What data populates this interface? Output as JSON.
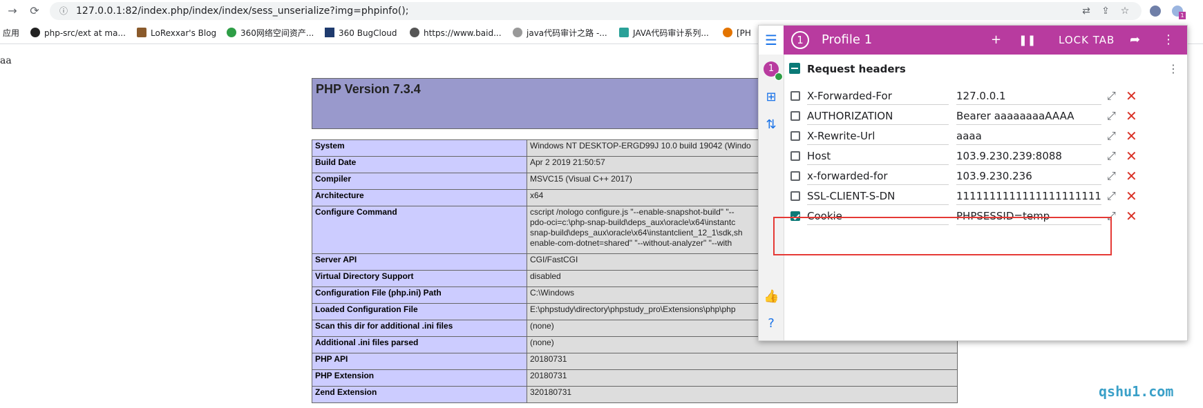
{
  "browser": {
    "url": "127.0.0.1:82/index.php/index/index/sess_unserialize?img=phpinfo();",
    "bookmarks": [
      "应用",
      "php-src/ext at ma...",
      "LoRexxar's Blog",
      "360网络空间资产...",
      "360 BugCloud",
      "https://www.baid...",
      "java代码审计之路 -...",
      "JAVA代码审计系列...",
      "[PH"
    ]
  },
  "page": {
    "text": "aa",
    "php_title": "PHP Version 7.3.4",
    "rows": [
      {
        "k": "System",
        "v": "Windows NT DESKTOP-ERGD99J 10.0 build 19042 (Windo"
      },
      {
        "k": "Build Date",
        "v": "Apr 2 2019 21:50:57"
      },
      {
        "k": "Compiler",
        "v": "MSVC15 (Visual C++ 2017)"
      },
      {
        "k": "Architecture",
        "v": "x64"
      },
      {
        "k": "Configure Command",
        "v1": "cscript /nologo configure.js \"--enable-snapshot-build\" \"--",
        "v2": "pdo-oci=c:\\php-snap-build\\deps_aux\\oracle\\x64\\instantc",
        "v3": "snap-build\\deps_aux\\oracle\\x64\\instantclient_12_1\\sdk,sh",
        "v4": "enable-com-dotnet=shared\" \"--without-analyzer\" \"--with"
      },
      {
        "k": "Server API",
        "v": "CGI/FastCGI"
      },
      {
        "k": "Virtual Directory Support",
        "v": "disabled"
      },
      {
        "k": "Configuration File (php.ini) Path",
        "v": "C:\\Windows"
      },
      {
        "k": "Loaded Configuration File",
        "v": "E:\\phpstudy\\directory\\phpstudy_pro\\Extensions\\php\\php"
      },
      {
        "k": "Scan this dir for additional .ini files",
        "v": "(none)"
      },
      {
        "k": "Additional .ini files parsed",
        "v": "(none)"
      },
      {
        "k": "PHP API",
        "v": "20180731"
      },
      {
        "k": "PHP Extension",
        "v": "20180731"
      },
      {
        "k": "Zend Extension",
        "v": "320180731"
      }
    ]
  },
  "popup": {
    "profile_number": "1",
    "profile_title": "Profile 1",
    "lock_label": "LOCK TAB",
    "section_title": "Request headers",
    "headers": [
      {
        "name": "X-Forwarded-For",
        "value": "127.0.0.1",
        "checked": false
      },
      {
        "name": "AUTHORIZATION",
        "value": "Bearer aaaaaaaaAAAA",
        "checked": false
      },
      {
        "name": "X-Rewrite-Url",
        "value": "aaaa",
        "checked": false
      },
      {
        "name": "Host",
        "value": "103.9.230.239:8088",
        "checked": false
      },
      {
        "name": "x-forwarded-for",
        "value": "103.9.230.236",
        "checked": false
      },
      {
        "name": "SSL-CLIENT-S-DN",
        "value": "11111111111111111111111111",
        "checked": false
      },
      {
        "name": "Cookie",
        "value": "PHPSESSID=temp",
        "checked": true
      }
    ]
  },
  "watermark": "qshu1.com",
  "colors": {
    "accent": "#b83b9f",
    "teal": "#0b7a77",
    "delete": "#d93025"
  }
}
